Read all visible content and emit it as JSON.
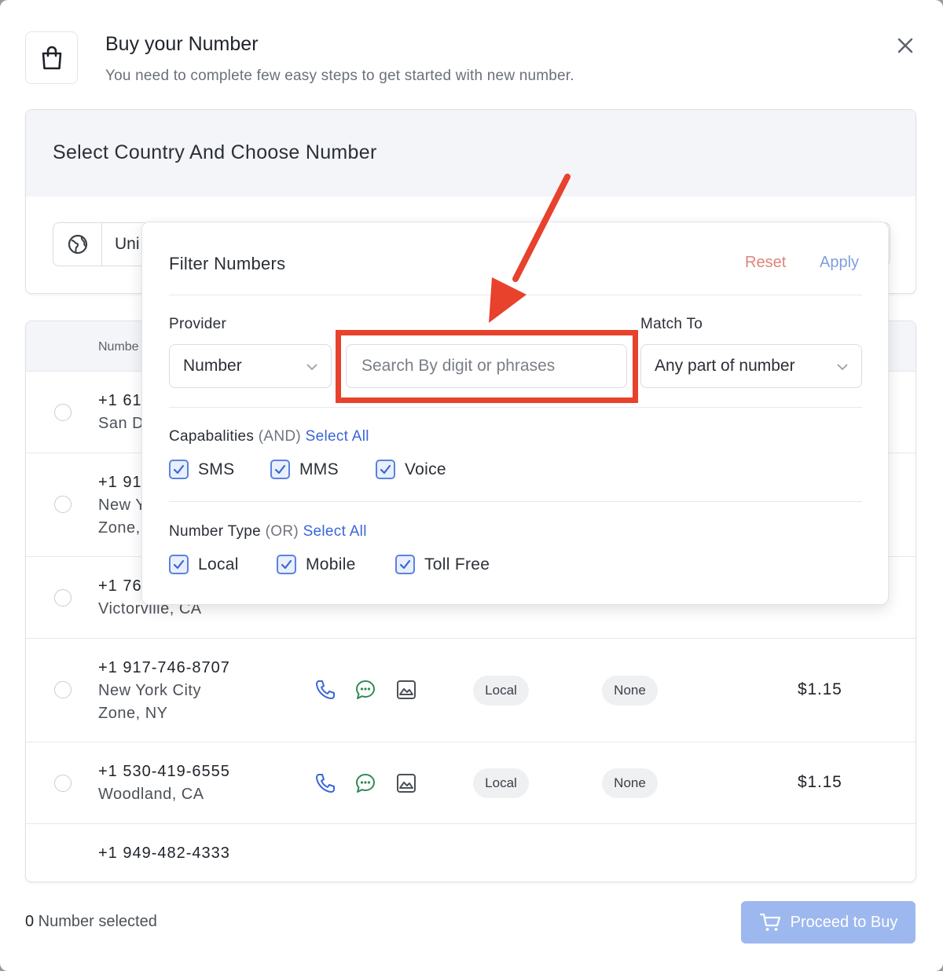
{
  "header": {
    "title": "Buy your Number",
    "subtitle": "You need to complete few easy steps to get started with new number."
  },
  "step": {
    "title": "Select Country And Choose Number",
    "country_value": "Uni"
  },
  "list": {
    "header_label": "Numbe",
    "rows": [
      {
        "number": "+1 61",
        "location": "San D"
      },
      {
        "number": "+1 91",
        "location_line1": "New Y",
        "location_line2": "Zone,"
      },
      {
        "number": "+1 76",
        "location": "Victorville, CA"
      },
      {
        "number": "+1 917-746-8707",
        "location_line1": "New York City",
        "location_line2": "Zone, NY",
        "type": "Local",
        "restriction": "None",
        "price": "$1.15"
      },
      {
        "number": "+1 530-419-6555",
        "location": "Woodland, CA",
        "type": "Local",
        "restriction": "None",
        "price": "$1.15"
      },
      {
        "number": "+1 949-482-4333"
      }
    ]
  },
  "footer": {
    "selected_count": "0",
    "selected_label": " Number selected",
    "proceed_label": "Proceed to Buy"
  },
  "filter": {
    "title": "Filter Numbers",
    "reset_label": "Reset",
    "apply_label": "Apply",
    "provider_label": "Provider",
    "provider_value": "Number",
    "search_placeholder": "Search By digit or phrases",
    "match_label": "Match To",
    "match_value": "Any part of number",
    "capabilities": {
      "label": "Capabalities",
      "qualifier": "(AND)",
      "select_all": "Select All",
      "options": [
        "SMS",
        "MMS",
        "Voice"
      ]
    },
    "number_type": {
      "label": "Number Type",
      "qualifier": "(OR)",
      "select_all": "Select All",
      "options": [
        "Local",
        "Mobile",
        "Toll Free"
      ]
    }
  },
  "colors": {
    "accent": "#3a66d8",
    "checkbox_border": "#5b82e0",
    "reset": "#e0837a",
    "apply": "#7e9ee0",
    "proceed_bg": "#9db8ef",
    "annotation": "#e8412c",
    "voice_icon": "#3a66d8",
    "sms_icon": "#2e8b57",
    "mms_icon": "#4c5159"
  },
  "icons": {
    "header": "shopping-bag-icon",
    "close": "close-icon",
    "country": "globe-icon",
    "voice": "phone-icon",
    "sms": "chat-icon",
    "mms": "image-icon",
    "proceed": "cart-icon",
    "dropdown": "chevron-down-icon",
    "checkbox": "check-icon"
  }
}
